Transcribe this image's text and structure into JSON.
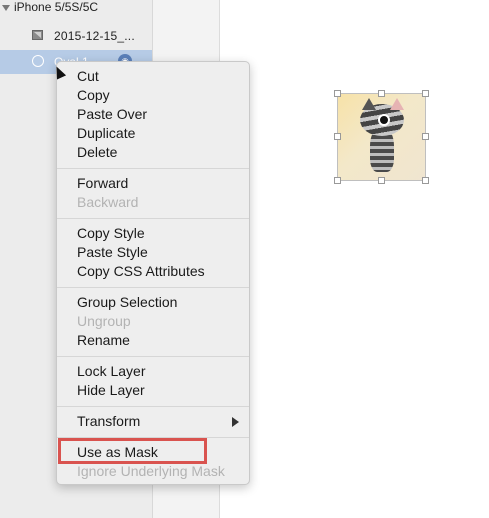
{
  "layers": {
    "group_label": "iPhone 5/5S/5C",
    "image_label": "2015-12-15_...",
    "oval_label": "Oval 1"
  },
  "menu": {
    "items": [
      {
        "label": "Cut",
        "enabled": true
      },
      {
        "label": "Copy",
        "enabled": true
      },
      {
        "label": "Paste Over",
        "enabled": true
      },
      {
        "label": "Duplicate",
        "enabled": true
      },
      {
        "label": "Delete",
        "enabled": true
      },
      {
        "label": "Forward",
        "enabled": true
      },
      {
        "label": "Backward",
        "enabled": false
      },
      {
        "label": "Copy Style",
        "enabled": true
      },
      {
        "label": "Paste Style",
        "enabled": true
      },
      {
        "label": "Copy CSS Attributes",
        "enabled": true
      },
      {
        "label": "Group Selection",
        "enabled": true
      },
      {
        "label": "Ungroup",
        "enabled": false
      },
      {
        "label": "Rename",
        "enabled": true
      },
      {
        "label": "Lock Layer",
        "enabled": true
      },
      {
        "label": "Hide Layer",
        "enabled": true
      },
      {
        "label": "Transform",
        "enabled": true
      },
      {
        "label": "Use as Mask",
        "enabled": true
      },
      {
        "label": "Ignore Underlying Mask",
        "enabled": false
      }
    ]
  },
  "colors": {
    "highlight_border": "#d9534f",
    "selected_row": "#b6cbe6"
  }
}
